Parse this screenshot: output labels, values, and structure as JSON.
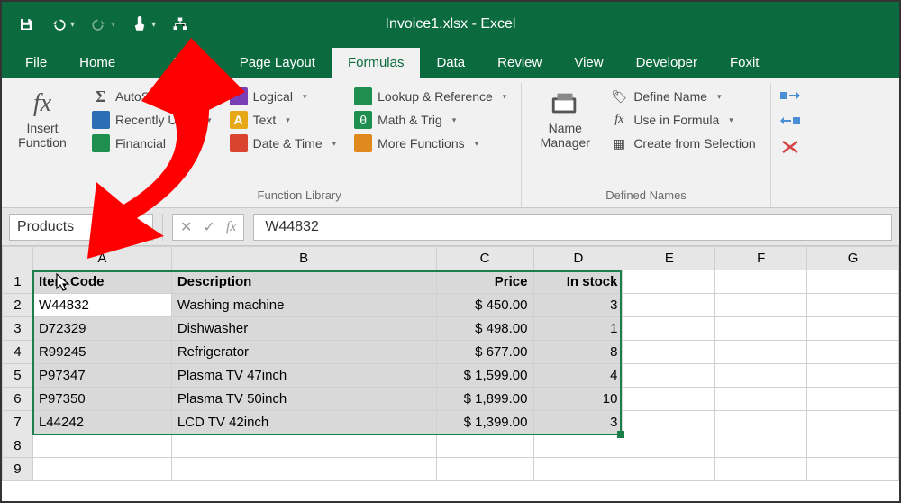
{
  "window_title": "Invoice1.xlsx - Excel",
  "tabs": [
    "File",
    "Home",
    "Insert",
    "Page Layout",
    "Formulas",
    "Data",
    "Review",
    "View",
    "Developer",
    "Foxit"
  ],
  "active_tab": "Formulas",
  "ribbon": {
    "insert_function": "Insert\nFunction",
    "autosum": "AutoSum",
    "recently_used": "Recently Used",
    "financial": "Financial",
    "logical": "Logical",
    "text": "Text",
    "date_time": "Date & Time",
    "lookup": "Lookup & Reference",
    "math_trig": "Math & Trig",
    "more_functions": "More Functions",
    "group_function_library": "Function Library",
    "name_manager": "Name\nManager",
    "define_name": "Define Name",
    "use_in_formula": "Use in Formula",
    "create_from_selection": "Create from Selection",
    "group_defined_names": "Defined Names"
  },
  "name_box": "Products",
  "formula_bar": "W44832",
  "columns": [
    "A",
    "B",
    "C",
    "D",
    "E",
    "F",
    "G"
  ],
  "rows": [
    1,
    2,
    3,
    4,
    5,
    6,
    7,
    8,
    9
  ],
  "headers": {
    "c1": "Item Code",
    "c2": "Description",
    "c3": "Price",
    "c4": "In stock"
  },
  "data": [
    {
      "code": "W44832",
      "desc": "Washing machine",
      "price": "$   450.00",
      "stock": "3"
    },
    {
      "code": "D72329",
      "desc": "Dishwasher",
      "price": "$   498.00",
      "stock": "1"
    },
    {
      "code": "R99245",
      "desc": "Refrigerator",
      "price": "$   677.00",
      "stock": "8"
    },
    {
      "code": "P97347",
      "desc": "Plasma TV 47inch",
      "price": "$ 1,599.00",
      "stock": "4"
    },
    {
      "code": "P97350",
      "desc": "Plasma TV 50inch",
      "price": "$ 1,899.00",
      "stock": "10"
    },
    {
      "code": "L44242",
      "desc": "LCD TV 42inch",
      "price": "$ 1,399.00",
      "stock": "3"
    }
  ]
}
